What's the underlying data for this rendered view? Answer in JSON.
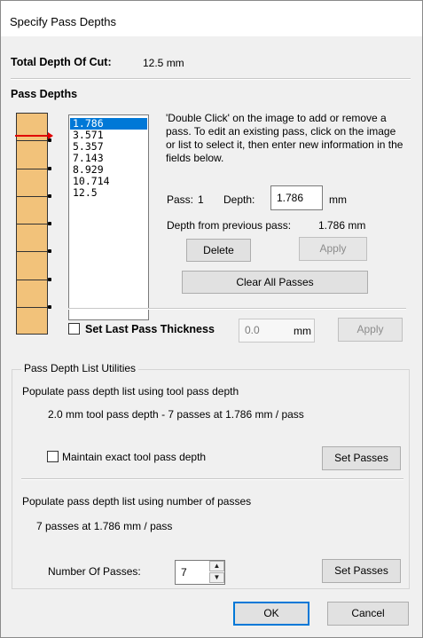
{
  "window": {
    "title": "Specify Pass Depths"
  },
  "total_depth": {
    "label": "Total Depth Of Cut:",
    "value": "12.5 mm"
  },
  "pass_depths": {
    "heading": "Pass Depths",
    "list": [
      "1.786",
      "3.571",
      "5.357",
      "7.143",
      "8.929",
      "10.714",
      "12.5"
    ],
    "selected_index": 0,
    "instructions": "'Double Click' on the image to add or remove a pass. To edit an existing pass, click on the image or list to select it, then enter new information in the fields below.",
    "pass_label": "Pass:",
    "pass_number": "1",
    "depth_label": "Depth:",
    "depth_value": "1.786",
    "depth_unit": "mm",
    "depth_from_prev_label": "Depth from previous pass:",
    "depth_from_prev_value": "1.786 mm",
    "delete_label": "Delete",
    "apply_label": "Apply",
    "clear_all_label": "Clear All Passes"
  },
  "last_pass": {
    "checkbox_label": "Set Last Pass Thickness",
    "checked": false,
    "value": "0.0",
    "unit": "mm",
    "apply_label": "Apply"
  },
  "utilities": {
    "legend": "Pass Depth List Utilities",
    "tool_heading": "Populate pass depth list using tool pass depth",
    "tool_summary": "2.0 mm tool pass depth - 7 passes at 1.786 mm / pass",
    "maintain_label": "Maintain exact tool pass depth",
    "maintain_checked": false,
    "set_passes_label_1": "Set Passes",
    "count_heading": "Populate pass depth list using number of passes",
    "count_summary": "7 passes at 1.786 mm / pass",
    "num_passes_label": "Number Of Passes:",
    "num_passes_value": "7",
    "set_passes_label_2": "Set Passes"
  },
  "footer": {
    "ok_label": "OK",
    "cancel_label": "Cancel"
  },
  "icons": {
    "spin_up": "spin-up-arrow-icon",
    "spin_down": "spin-down-arrow-icon",
    "marker": "active-pass-marker"
  },
  "colors": {
    "ruler_fill": "#f2c27a",
    "active_marker": "#e00000",
    "selection": "#0078d7"
  }
}
